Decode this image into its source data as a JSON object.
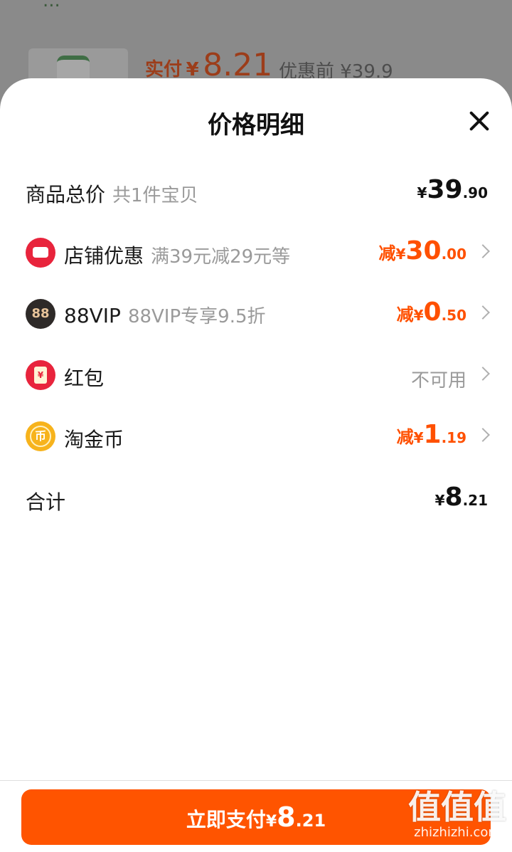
{
  "background": {
    "top_text": "...",
    "price_label": "实付",
    "price_currency": "¥",
    "price_value": "8.21",
    "original_price": "优惠前 ¥39.9"
  },
  "sheet": {
    "title": "价格明细",
    "close_icon": "close-icon",
    "rows": [
      {
        "label": "商品总价",
        "sub": "共1件宝贝",
        "currency": "¥",
        "int": "39",
        "dec": ".90",
        "style": "black"
      },
      {
        "icon": "shop-icon",
        "label": "店铺优惠",
        "sub": "满39元减29元等",
        "prefix": "减",
        "currency": "¥",
        "int": "30",
        "dec": ".00",
        "style": "orange"
      },
      {
        "icon": "88vip-icon",
        "icon_text": "88",
        "label": "88VIP",
        "sub": "88VIP专享9.5折",
        "prefix": "减",
        "currency": "¥",
        "int": "0",
        "dec": ".50",
        "style": "orange"
      },
      {
        "icon": "red-packet-icon",
        "icon_text": "¥",
        "label": "红包",
        "status": "不可用"
      },
      {
        "icon": "taojinbi-coin-icon",
        "icon_text": "币",
        "label": "淘金币",
        "prefix": "减",
        "currency": "¥",
        "int": "1",
        "dec": ".19",
        "style": "orange"
      }
    ],
    "total": {
      "label": "合计",
      "currency": "¥",
      "int": "8",
      "dec": ".21"
    }
  },
  "pay_button": {
    "label": "立即支付",
    "currency": "¥",
    "int": "8",
    "dec": ".21"
  },
  "watermark": {
    "text": "值值值",
    "sub": "zhizhizhi.com"
  },
  "colors": {
    "accent": "#ff5000",
    "button": "#ff5400",
    "shop_icon": "#e8243c",
    "coin_icon": "#f7b31c"
  }
}
